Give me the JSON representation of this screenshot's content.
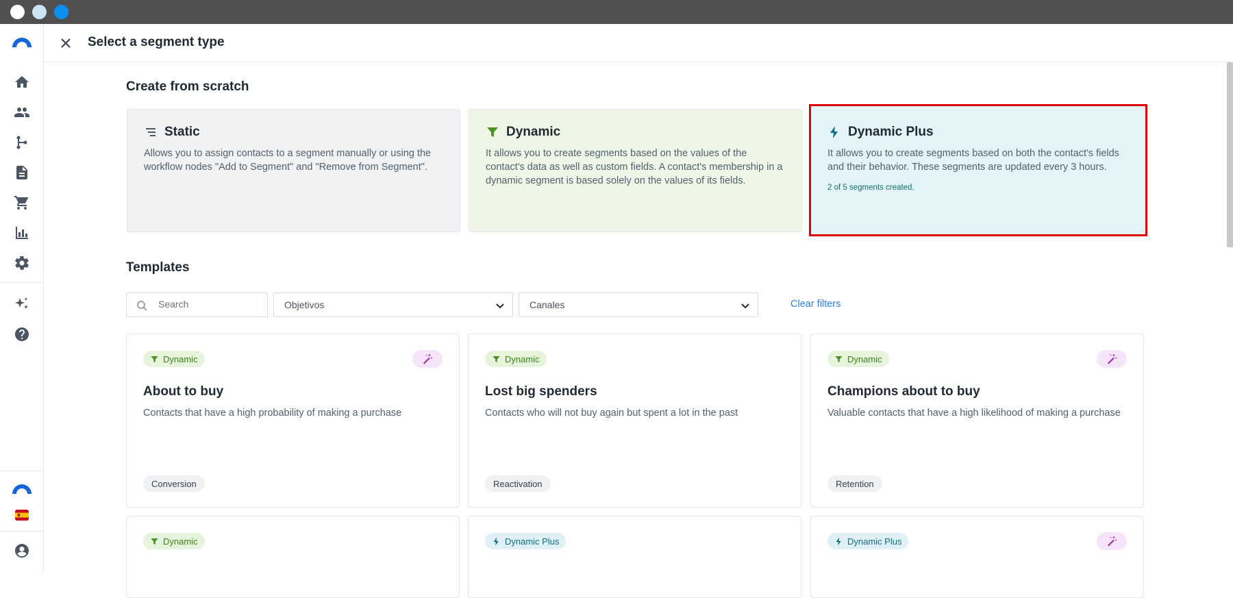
{
  "window": {
    "title": "Select a segment type"
  },
  "sidebar": {
    "items": [
      {
        "name": "home-icon"
      },
      {
        "name": "contacts-icon"
      },
      {
        "name": "workflows-icon"
      },
      {
        "name": "documents-icon"
      },
      {
        "name": "cart-icon"
      },
      {
        "name": "reports-icon"
      },
      {
        "name": "settings-icon"
      },
      {
        "name": "ai-sparkle-icon"
      },
      {
        "name": "help-icon"
      }
    ]
  },
  "scratch": {
    "title": "Create from scratch",
    "cards": [
      {
        "name": "Static",
        "icon": "list-icon",
        "description": "Allows you to assign contacts to a segment manually or using the workflow nodes \"Add to Segment\" and \"Remove from Segment\"."
      },
      {
        "name": "Dynamic",
        "icon": "filter-icon",
        "description": "It allows you to create segments based on the values of the contact's data as well as custom fields. A contact's membership in a dynamic segment is based solely on the values of its fields."
      },
      {
        "name": "Dynamic Plus",
        "icon": "bolt-icon",
        "description": "It allows you to create segments based on both the contact's fields and their behavior. These segments are updated every 3 hours.",
        "meta": "2 of 5 segments created."
      }
    ]
  },
  "templates": {
    "title": "Templates",
    "search": {
      "placeholder": "Search",
      "value": ""
    },
    "filters": [
      {
        "selected": "Objetivos"
      },
      {
        "selected": "Canales"
      }
    ],
    "clear_label": "Clear filters",
    "items": [
      {
        "badge": "Dynamic",
        "ai": true,
        "title": "About to buy",
        "description": "Contacts that have a high probability of making a purchase",
        "tag": "Conversion"
      },
      {
        "badge": "Dynamic",
        "ai": false,
        "title": "Lost big spenders",
        "description": "Contacts who will not buy again but spent a lot in the past",
        "tag": "Reactivation"
      },
      {
        "badge": "Dynamic",
        "ai": true,
        "title": "Champions about to buy",
        "description": "Valuable contacts that have a high likelihood of making a purchase",
        "tag": "Retention"
      },
      {
        "badge": "Dynamic",
        "ai": false
      },
      {
        "badge": "Dynamic Plus",
        "ai": false
      },
      {
        "badge": "Dynamic Plus",
        "ai": true
      }
    ]
  },
  "colors": {
    "highlight_border": "#e00000",
    "link": "#2f80d7",
    "dynamic_green": "#3f7f1c",
    "plus_teal": "#136b80"
  }
}
